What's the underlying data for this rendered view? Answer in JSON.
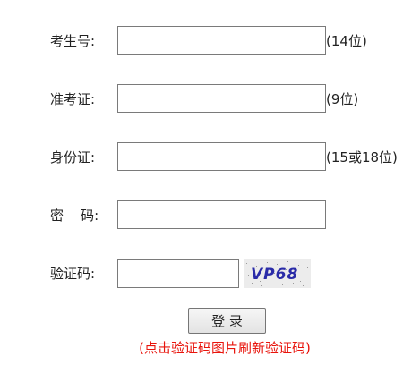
{
  "form": {
    "exam_no": {
      "label": "考生号:",
      "value": "",
      "hint": "(14位)"
    },
    "admission_no": {
      "label": "准考证:",
      "value": "",
      "hint": "(9位)"
    },
    "id_card": {
      "label": "身份证:",
      "value": "",
      "hint": "(15或18位)"
    },
    "password": {
      "label": "密    码:",
      "value": ""
    },
    "captcha": {
      "label": "验证码:",
      "value": "",
      "image_text": "VP68"
    },
    "login_label": "登 录",
    "captcha_tip": "(点击验证码图片刷新验证码)"
  },
  "colors": {
    "tip": "#e8140c",
    "captcha_text": "#2a2ba8",
    "captcha_bg": "#ececec"
  }
}
